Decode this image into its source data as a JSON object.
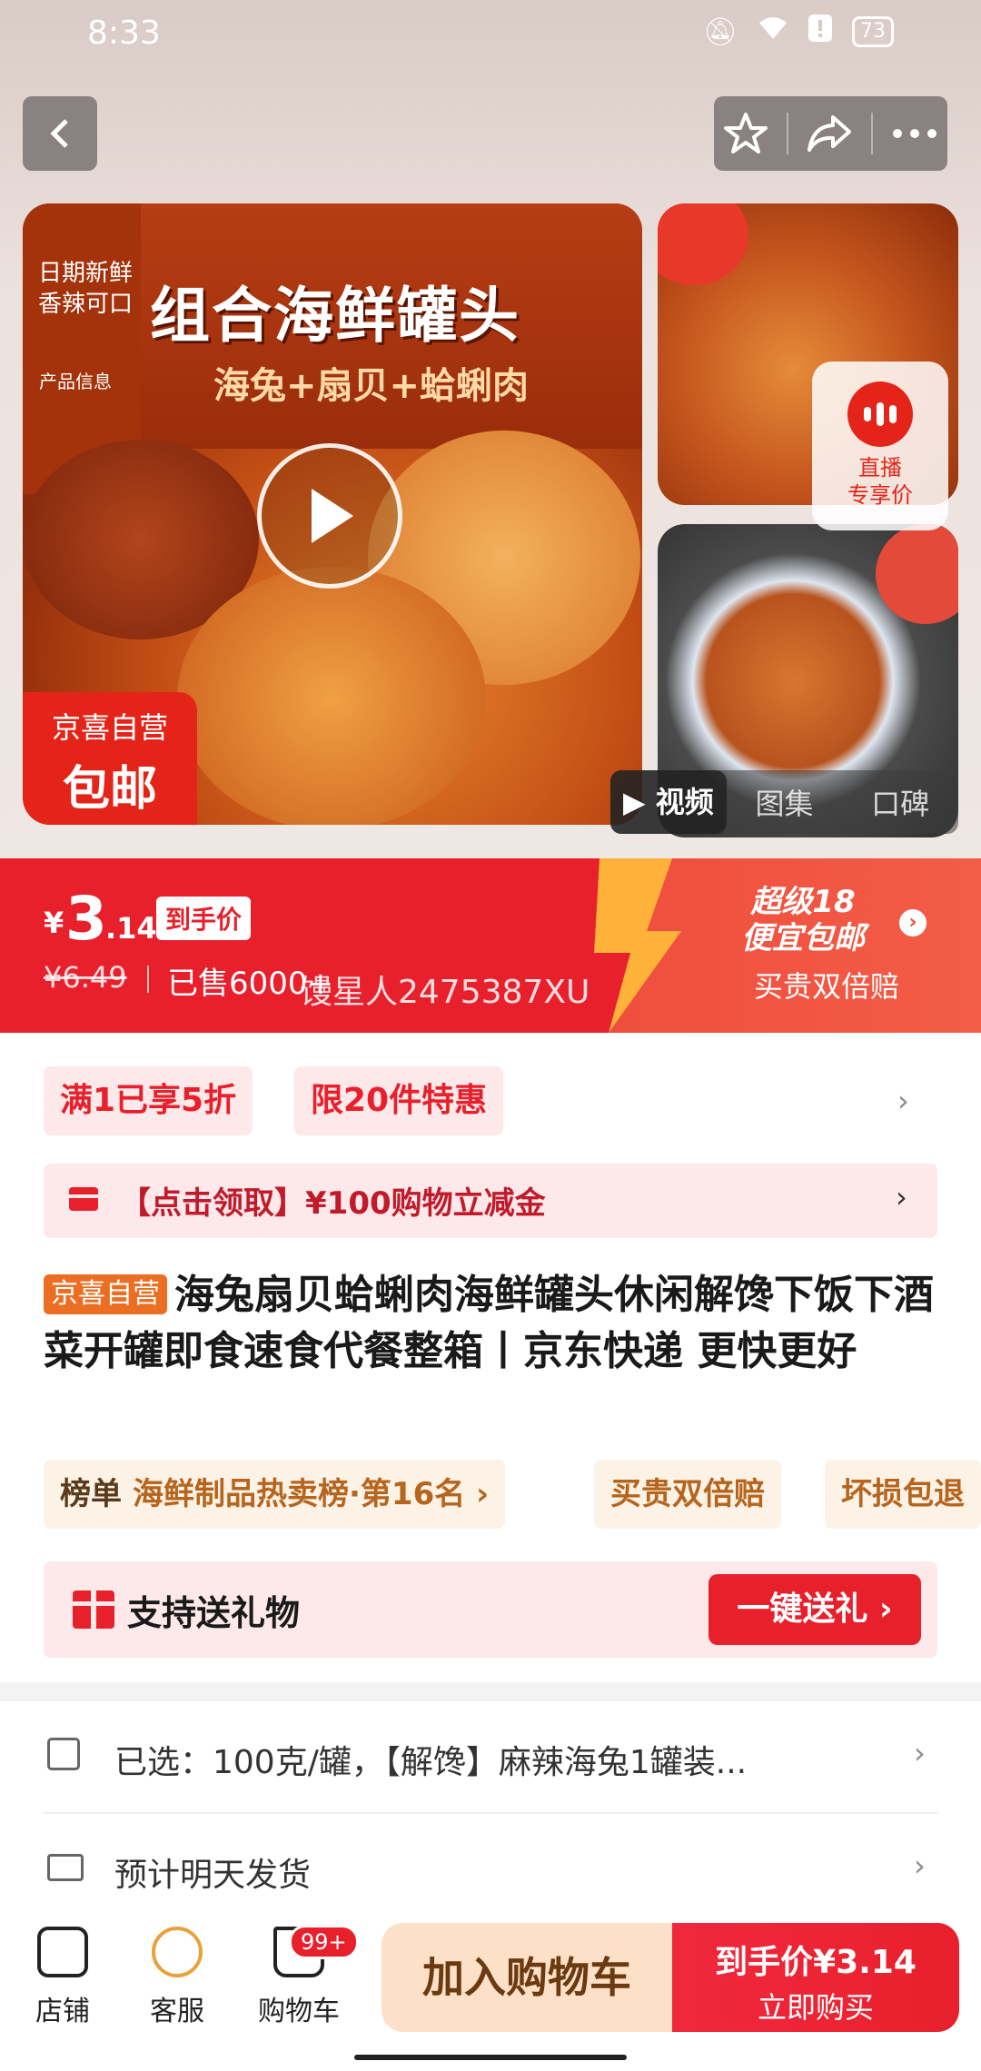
{
  "status_bar": {
    "time": "8:33",
    "battery": "73"
  },
  "product_image": {
    "side_text": "日期新鲜香辣可口",
    "side_small": "产品信息",
    "title": "组合海鲜罐头",
    "subtitle": "海兔+扇贝+蛤蜊肉",
    "free_ship_top": "京喜自营",
    "free_ship_bottom": "包邮"
  },
  "live_badge": {
    "line1": "直播",
    "line2": "专享价"
  },
  "media_tabs": [
    "▶ 视频",
    "图集",
    "口碑"
  ],
  "price": {
    "currency": "¥",
    "integer": "3",
    "decimal": ".14",
    "tag": "到手价",
    "original": "¥6.49",
    "sold": "已售6000+",
    "watermark": "馒星人2475387XU",
    "promo_title_1": "超级18",
    "promo_title_2": "便宜包邮",
    "promo_sub": "买贵双倍赔"
  },
  "promos": {
    "chip1": "满1已享5折",
    "chip2": "限20件特惠"
  },
  "coupon": {
    "text": "【点击领取】¥100购物立减金"
  },
  "title": {
    "badge": "京喜自营",
    "text": "海兔扇贝蛤蜊肉海鲜罐头休闲解馋下饭下酒菜开罐即食速食代餐整箱丨京东快递 更快更好"
  },
  "tags": {
    "rank_key": "榜单",
    "rank_value": "海鲜制品热卖榜·第16名 ›",
    "t2": "买贵双倍赔",
    "t3": "坏损包退"
  },
  "gift": {
    "text": "支持送礼物",
    "button": "一键送礼 ›"
  },
  "selection": {
    "text": "已选：100克/罐，【解馋】麻辣海兔1罐装..."
  },
  "shipping": {
    "text": "预计明天发货"
  },
  "bottom_bar": {
    "shop": "店铺",
    "service": "客服",
    "cart": "购物车",
    "cart_badge": "99+",
    "add_cart": "加入购物车",
    "buy_price": "到手价¥3.14",
    "buy_label": "立即购买"
  },
  "colors": {
    "brand_red": "#e8202c",
    "self_badge": "#ec6e23",
    "tag_brown": "#b5651d"
  }
}
